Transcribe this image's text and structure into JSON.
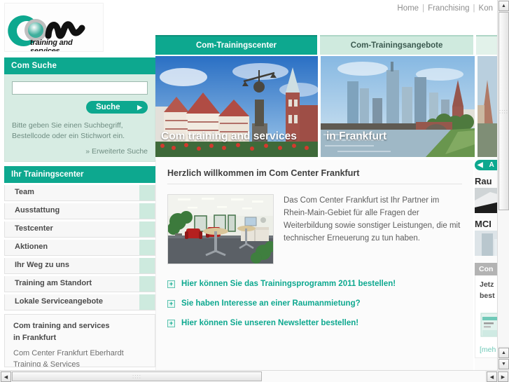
{
  "topnav": {
    "items": [
      "Home",
      "Franchising",
      "Kon"
    ],
    "separator": "|"
  },
  "logo": {
    "wordmark": "om",
    "tagline": "training and services",
    "brand_color": "#0da88f"
  },
  "search": {
    "panel_title": "Com Suche",
    "input_value": "",
    "input_placeholder": "",
    "button_label": "Suche",
    "button_arrow": "▶",
    "hint": "Bitte geben Sie einen Suchbegriff, Bestellcode oder ein Stichwort ein.",
    "advanced_link": "» Erweiterte Suche"
  },
  "sidebar": {
    "title": "Ihr Trainingscenter",
    "items": [
      {
        "label": "Team"
      },
      {
        "label": "Ausstattung"
      },
      {
        "label": "Testcenter"
      },
      {
        "label": "Aktionen"
      },
      {
        "label": "Ihr Weg zu uns"
      },
      {
        "label": "Training am Standort"
      },
      {
        "label": "Lokale Serviceangebote"
      }
    ],
    "address": {
      "title_line1": "Com training and services",
      "title_line2": "in Frankfurt",
      "body": "Com Center Frankfurt Eberhardt Training & Services"
    }
  },
  "tabs": [
    {
      "label": "Com-Trainingscenter",
      "active": true
    },
    {
      "label": "Com-Trainingsangebote",
      "active": false
    },
    {
      "label": "",
      "active": false
    }
  ],
  "heroes": [
    {
      "caption": "Com training and services",
      "alt": "roemerberg-frankfurt-photo"
    },
    {
      "caption": "in Frankfurt",
      "alt": "frankfurt-skyline-main-river-photo"
    },
    {
      "caption": "",
      "alt": "third-hero-sliver-photo"
    }
  ],
  "main": {
    "heading": "Herzlich willkommen im Com Center Frankfurt",
    "photo_alt": "com-center-lounge-photo",
    "paragraph": "Das Com Center Frankfurt ist Ihr Partner im Rhein-Main-Gebiet für alle Fragen der Weiterbildung sowie sonstiger Leistungen, die mit technischer Erneuerung zu tun haben.",
    "links": [
      {
        "icon": "plus-icon",
        "label": "Hier können Sie das Trainingsprogramm 2011 bestellen!"
      },
      {
        "icon": "plus-icon",
        "label": "Sie haben Interesse an einer Raumanmietung?"
      },
      {
        "icon": "plus-icon",
        "label": "Hier können Sie unseren Newsletter bestellen!"
      }
    ],
    "link_color": "#0da88f"
  },
  "rail": {
    "back_button": {
      "arrow": "◀",
      "label": "A"
    },
    "heading_1": "Rau",
    "heading_2": "MCI",
    "bar_label": "Con",
    "card_line1": "Jetz",
    "card_line2": "best",
    "more_link": "[meh"
  },
  "scrollbars": {
    "vertical": {
      "up": "▲",
      "down": "▼"
    },
    "horizontal": {
      "left": "◀",
      "right": "▶"
    },
    "grip": "::::"
  }
}
